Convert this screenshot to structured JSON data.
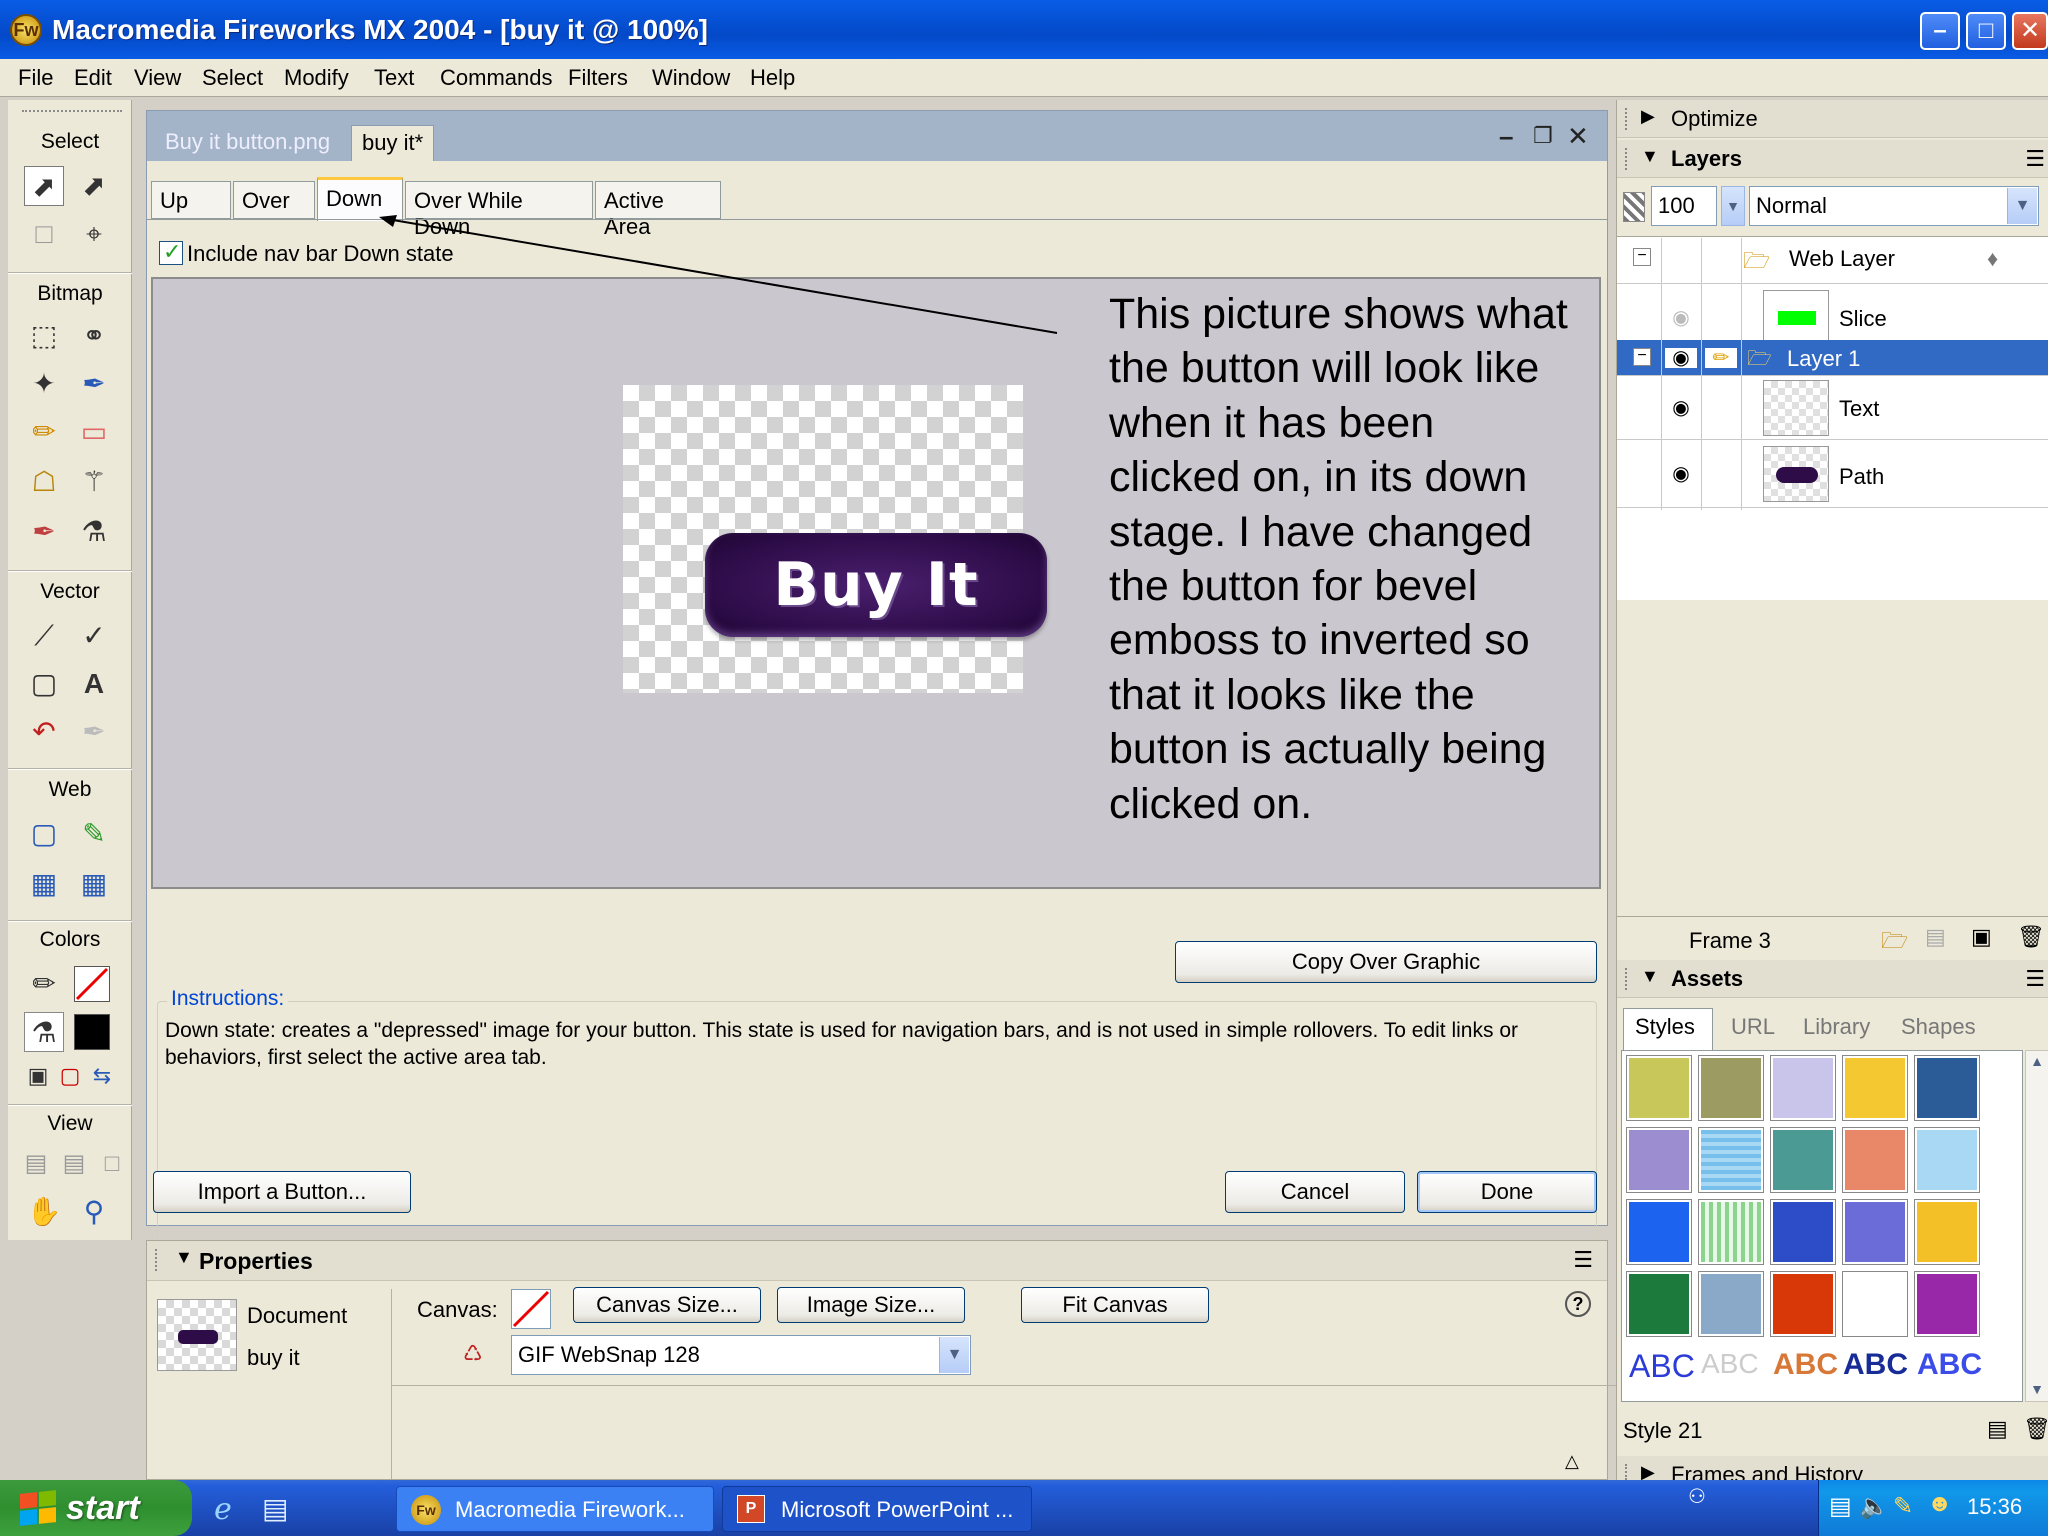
{
  "window": {
    "title": "Macromedia Fireworks MX 2004 - [buy it @ 100%]",
    "app_icon": "fw-logo-icon"
  },
  "menu": [
    "File",
    "Edit",
    "View",
    "Select",
    "Modify",
    "Text",
    "Commands",
    "Filters",
    "Window",
    "Help"
  ],
  "tools": {
    "sections": [
      "Select",
      "Bitmap",
      "Vector",
      "Web",
      "Colors",
      "View"
    ]
  },
  "document": {
    "tabs": [
      "Buy it button.png",
      "buy it*"
    ],
    "state_tabs": [
      "Up",
      "Over",
      "Down",
      "Over While Down",
      "Active Area"
    ],
    "active_state": "Down",
    "include_checkbox_label": "Include nav bar Down state",
    "button_text": "Buy It",
    "annotation": "This picture shows what the button will look like when it has been clicked on, in its down stage. I have changed the button for bevel emboss to inverted so that it looks like the button is actually being clicked on.",
    "copy_over_label": "Copy Over Graphic",
    "instructions_label": "Instructions:",
    "instructions_text": "Down state: creates a \"depressed\" image for your button. This state is used for navigation bars, and is not used in simple rollovers. To edit links or behaviors, first select the active area tab.",
    "import_label": "Import a Button...",
    "cancel_label": "Cancel",
    "done_label": "Done"
  },
  "properties": {
    "title": "Properties",
    "doc_type": "Document",
    "doc_name": "buy it",
    "canvas_label": "Canvas:",
    "canvas_size_label": "Canvas Size...",
    "image_size_label": "Image Size...",
    "fit_canvas_label": "Fit Canvas",
    "export_setting": "GIF WebSnap 128",
    "help_icon": "?"
  },
  "panels": {
    "optimize": "Optimize",
    "layers": {
      "title": "Layers",
      "opacity": "100",
      "blend": "Normal",
      "rows": [
        {
          "name": "Web Layer"
        },
        {
          "name": "Slice"
        },
        {
          "name": "Layer 1"
        },
        {
          "name": "Text"
        },
        {
          "name": "Path"
        }
      ],
      "frame": "Frame 3"
    },
    "assets": {
      "title": "Assets",
      "tabs": [
        "Styles",
        "URL",
        "Library",
        "Shapes"
      ],
      "style_label": "Style 21",
      "abc": [
        "ABC",
        "ABC",
        "ABC",
        "ABC",
        "ABC"
      ]
    },
    "frames": "Frames and History"
  },
  "taskbar": {
    "start": "start",
    "tasks": [
      "Macromedia Firework...",
      "Microsoft PowerPoint ..."
    ],
    "clock": "15:36"
  },
  "colors": {
    "accent": "#316ac5",
    "button_fill": "#2d0c48",
    "slice_green": "#00ff00"
  }
}
